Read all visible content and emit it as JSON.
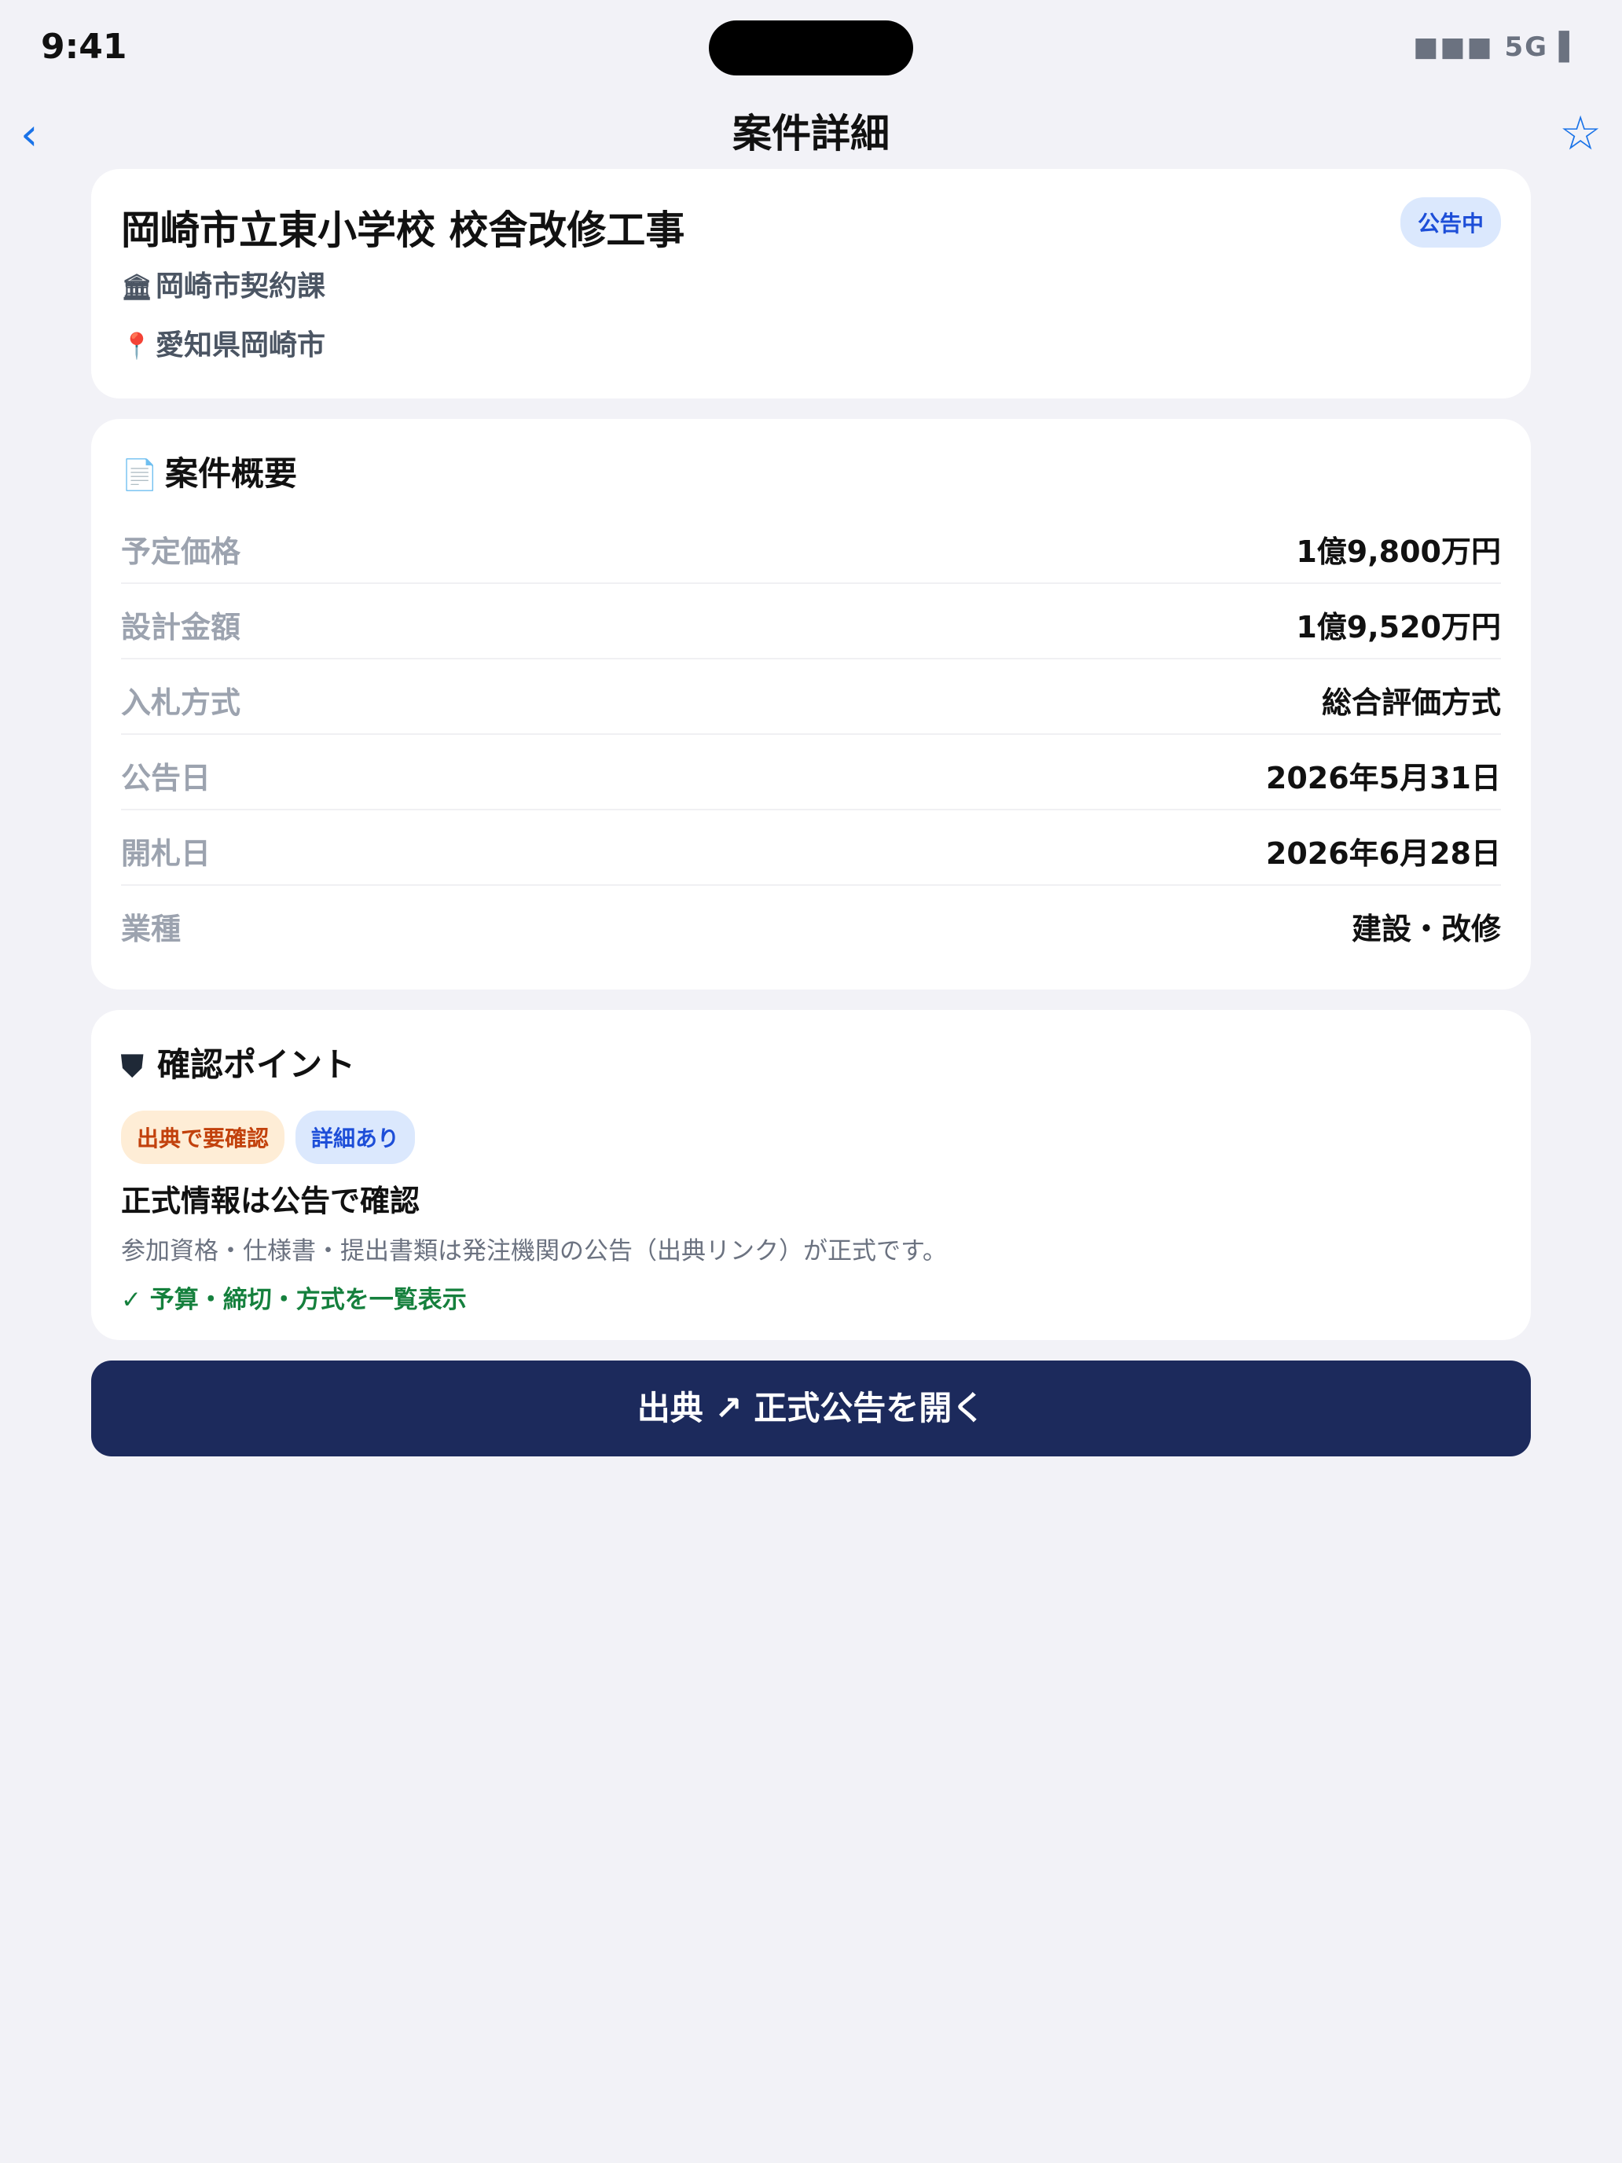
{
  "status_bar": {
    "time": "9:41",
    "signal": "■■■ 5G ▌"
  },
  "nav": {
    "back": "‹",
    "title": "案件詳細",
    "favorite": "☆"
  },
  "summary": {
    "title": "岡崎市立東小学校 校舎改修工事",
    "status_badge": "公告中",
    "agency_icon": "🏛",
    "agency": "岡崎市契約課",
    "location_icon": "📍",
    "location": "愛知県岡崎市"
  },
  "overview": {
    "icon": "📄",
    "title": "案件概要",
    "rows": [
      {
        "label": "予定価格",
        "value": "1億9,800万円"
      },
      {
        "label": "設計金額",
        "value": "1億9,520万円"
      },
      {
        "label": "入札方式",
        "value": "総合評価方式"
      },
      {
        "label": "公告日",
        "value": "2026年5月31日"
      },
      {
        "label": "開札日",
        "value": "2026年6月28日"
      },
      {
        "label": "業種",
        "value": "建設・改修"
      }
    ]
  },
  "check_points": {
    "icon": "⛊",
    "title": "確認ポイント",
    "tags": [
      "出典で要確認",
      "詳細あり"
    ],
    "heading": "正式情報は公告で確認",
    "description": "参加資格・仕様書・提出書類は発注機関の公告（出典リンク）が正式です。",
    "confirmation": "✓ 予算・締切・方式を一覧表示"
  },
  "source_button": {
    "label": "出典 ↗ 正式公告を開く"
  },
  "colors": {
    "accent": "#1a73e8",
    "button": "#1c2a5c",
    "background": "#f2f2f7",
    "badge_blue_bg": "#dbe8fd",
    "badge_orange_bg": "#feedd6",
    "success": "#15803d"
  },
  "icons": {
    "back": "chevron-left-icon",
    "favorite": "star-icon",
    "agency": "government-building-icon",
    "location": "pin-icon",
    "overview": "document-icon",
    "check_points": "shield-icon"
  }
}
